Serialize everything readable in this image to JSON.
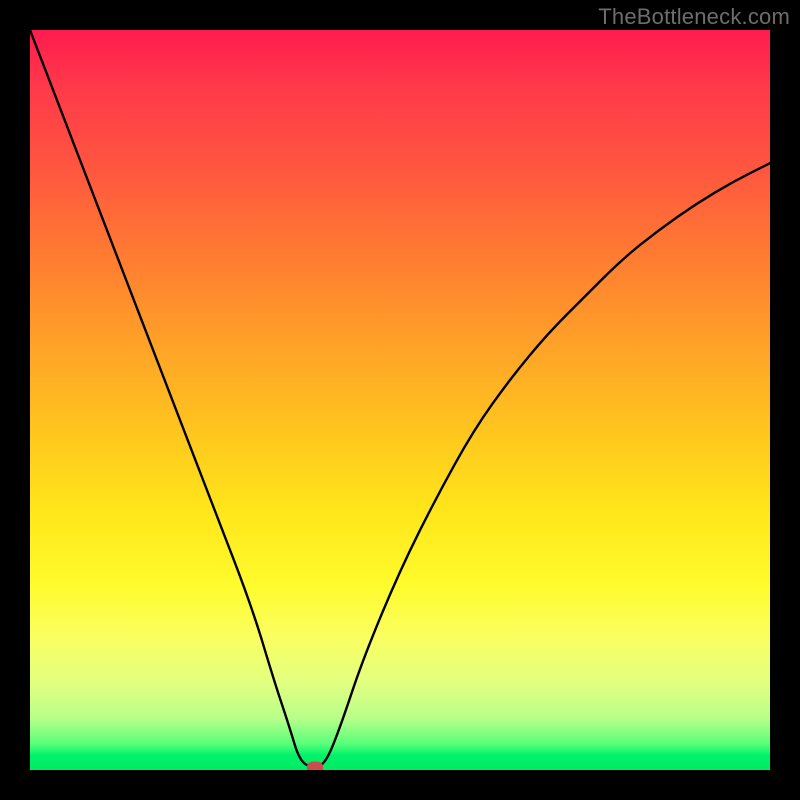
{
  "watermark": "TheBottleneck.com",
  "chart_data": {
    "type": "line",
    "title": "",
    "xlabel": "",
    "ylabel": "",
    "xlim": [
      0,
      100
    ],
    "ylim": [
      0,
      100
    ],
    "grid": false,
    "legend": false,
    "series": [
      {
        "name": "curve",
        "x": [
          0,
          5,
          10,
          15,
          20,
          25,
          30,
          33,
          35,
          36.5,
          38.5,
          40,
          42,
          45,
          50,
          55,
          60,
          65,
          70,
          75,
          80,
          85,
          90,
          95,
          100
        ],
        "y": [
          100,
          87,
          74,
          61,
          48,
          35,
          22,
          12,
          6,
          1,
          0.3,
          1,
          6,
          15,
          27,
          37,
          46,
          53,
          59,
          64,
          69,
          73,
          76.5,
          79.5,
          82
        ],
        "color": "#000000"
      }
    ],
    "marker": {
      "x": 38.5,
      "y": 0.3,
      "color": "#c94f4f"
    },
    "background_gradient": {
      "direction": "top-to-bottom",
      "stops": [
        {
          "pos": 0.0,
          "color": "#ff1c4f"
        },
        {
          "pos": 0.3,
          "color": "#ff7a32"
        },
        {
          "pos": 0.55,
          "color": "#ffc81e"
        },
        {
          "pos": 0.75,
          "color": "#fffb2c"
        },
        {
          "pos": 0.93,
          "color": "#b8ff8a"
        },
        {
          "pos": 1.0,
          "color": "#00ea63"
        }
      ]
    }
  }
}
